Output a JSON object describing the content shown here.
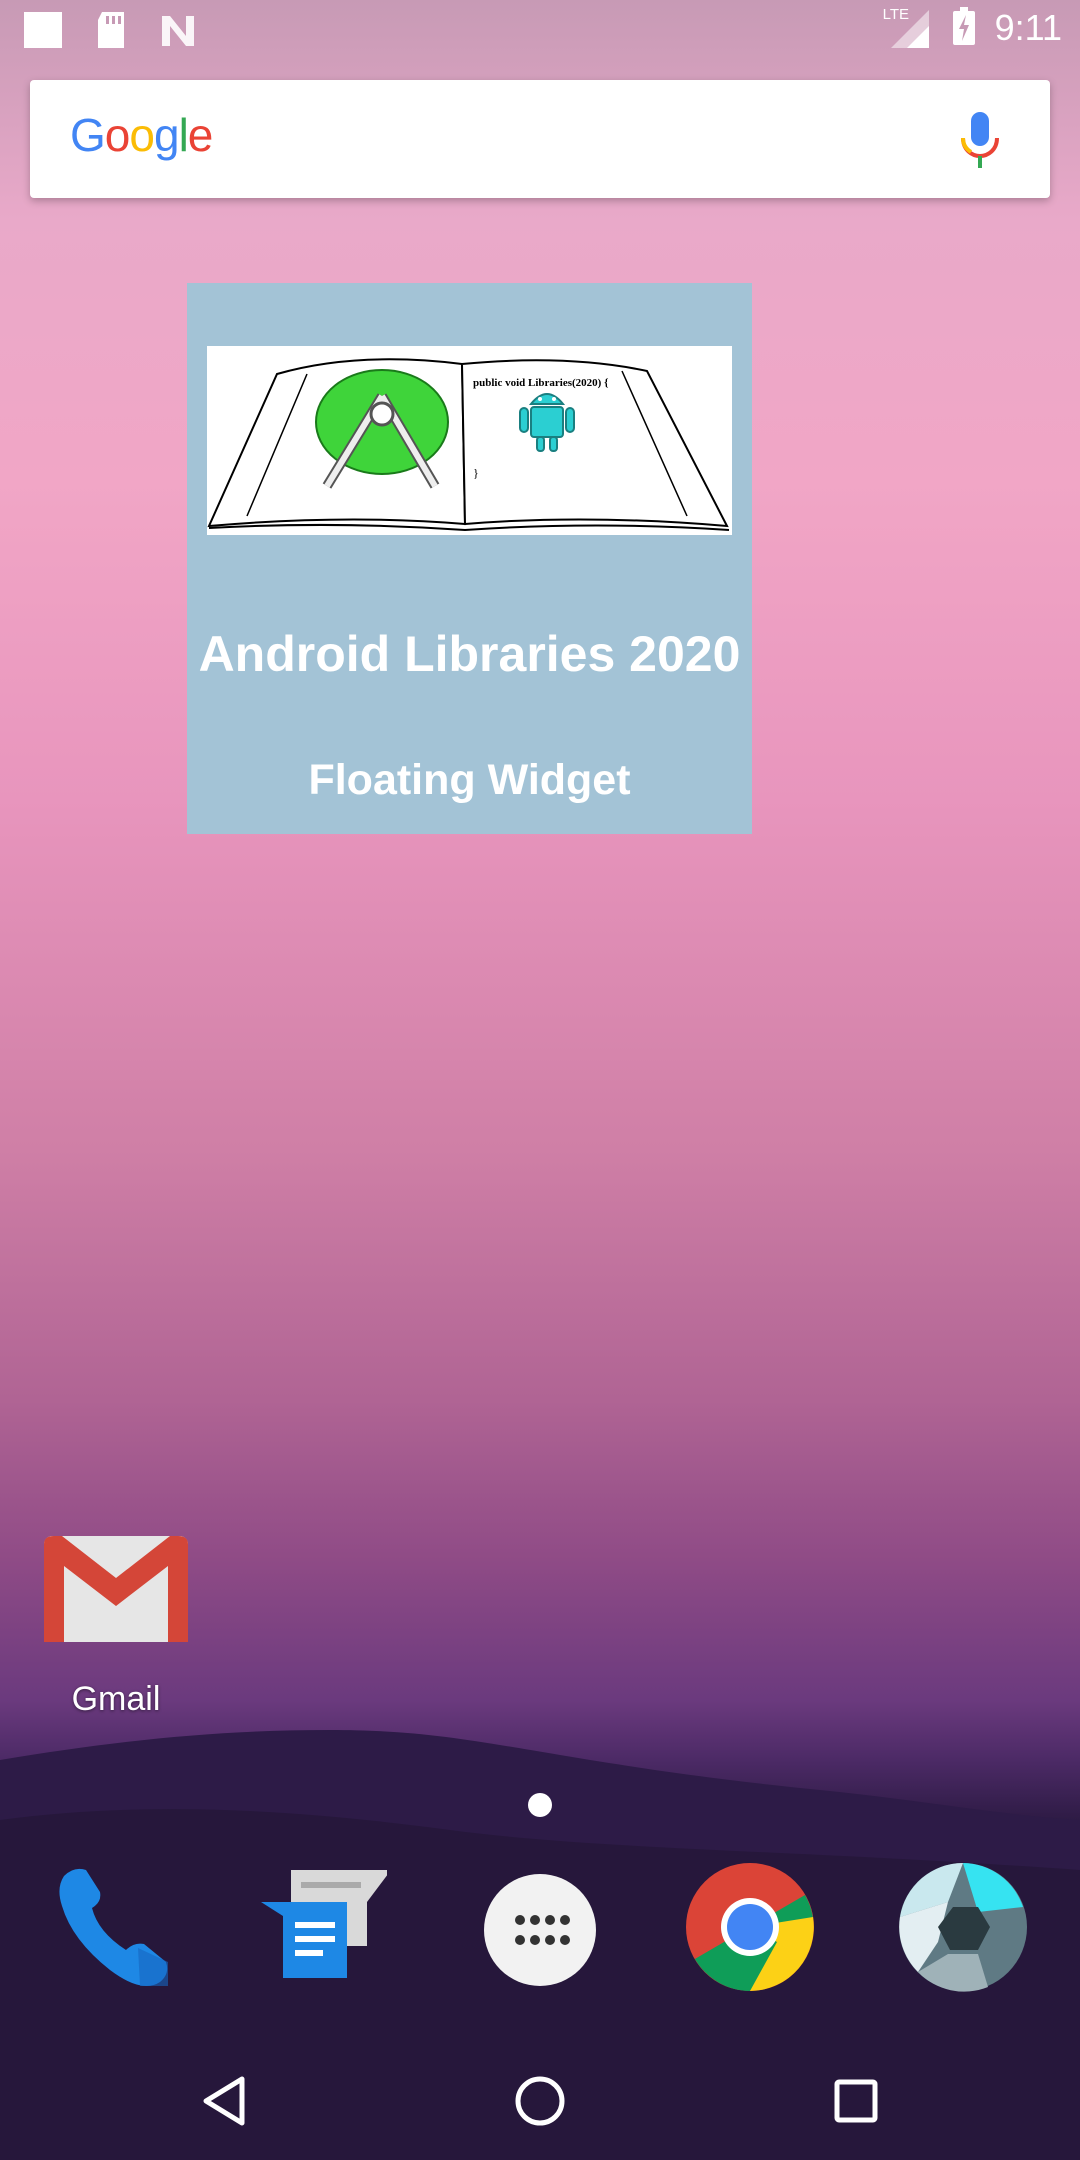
{
  "status_bar": {
    "time": "9:11",
    "network_label": "LTE",
    "icons": [
      "notification-square-icon",
      "sd-card-icon",
      "n-logo-icon",
      "lte-signal-icon",
      "battery-charging-icon"
    ]
  },
  "search_bar": {
    "logo_text": "Google",
    "logo_colors": [
      "#4285F4",
      "#EA4335",
      "#FBBC05",
      "#4285F4",
      "#34A853",
      "#EA4335"
    ],
    "mic_icon": "microphone-icon"
  },
  "widget": {
    "title": "Android Libraries 2020",
    "subtitle": "Floating Widget",
    "image_caption": "public void Libraries(2020) {",
    "image_closing_brace": "}",
    "background": "#a3c3d6"
  },
  "home_apps": [
    {
      "label": "Gmail",
      "icon": "gmail-icon"
    }
  ],
  "dock": [
    {
      "icon": "phone-icon"
    },
    {
      "icon": "messages-icon"
    },
    {
      "icon": "app-drawer-icon"
    },
    {
      "icon": "chrome-icon"
    },
    {
      "icon": "camera-icon"
    }
  ],
  "nav_bar": {
    "buttons": [
      "back-icon",
      "home-icon",
      "recents-icon"
    ]
  }
}
